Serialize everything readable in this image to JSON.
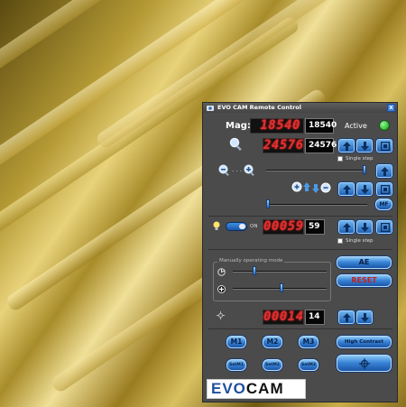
{
  "window": {
    "title": "EVO CAM Remote Control",
    "close_label": "x"
  },
  "mag": {
    "label": "Mag:",
    "display": "18540",
    "value": "18540",
    "status": "Active",
    "status_color": "#3ecb3e"
  },
  "zoom": {
    "display": "24576",
    "value": "24576",
    "single_step_label": "Single step",
    "single_step_checked": false,
    "slider_level": 1.0
  },
  "focus": {
    "slider_level": 0.0,
    "mf_label": "MF"
  },
  "light": {
    "toggle_state": "ON",
    "display": "00059",
    "value": "59",
    "single_step_label": "Single step",
    "single_step_checked": false
  },
  "manual": {
    "legend": "Manually operating mode",
    "slider1_level": 0.2,
    "slider2_level": 0.5,
    "ae_label": "AE",
    "reset_label": "RESET"
  },
  "aperture": {
    "display": "00014",
    "value": "14"
  },
  "memory": {
    "m1_label": "M1",
    "m2_label": "M2",
    "m3_label": "M3",
    "set1_label": "SetM1",
    "set2_label": "SetM2",
    "set3_label": "SetM3",
    "high_contrast_label": "High Contrast"
  },
  "logo": {
    "text_evo": "EVO",
    "text_cam": "CAM"
  }
}
